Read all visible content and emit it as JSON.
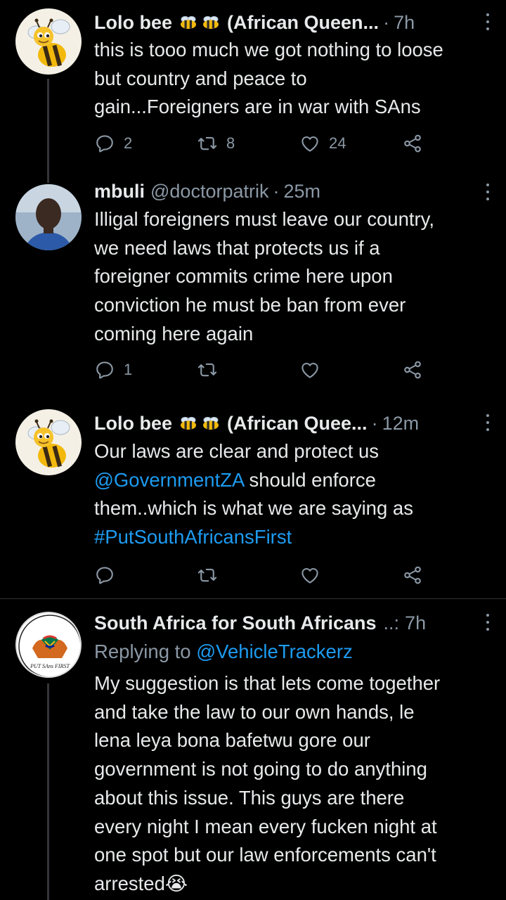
{
  "tweets": [
    {
      "name": "Lolo bee",
      "name_suffix": "(African Queen...",
      "time": "7h",
      "lines": [
        "this is tooo much we got nothing to loose",
        "but country and peace to",
        "gain...Foreigners are in war with SAns"
      ],
      "replies": "2",
      "retweets": "8",
      "likes": "24"
    },
    {
      "name": "mbuli",
      "handle": "@doctorpatrik",
      "time": "25m",
      "lines": [
        "Illigal foreigners must leave our country,",
        "we need laws that protects us if a",
        "foreigner commits crime here upon",
        "conviction he must be ban from ever",
        "coming here again"
      ],
      "replies": "1"
    },
    {
      "name": "Lolo bee",
      "name_suffix": "(African Quee...",
      "time": "12m",
      "line1": "Our laws are clear and protect us",
      "mention": "@GovernmentZA",
      "line2_rest": " should enforce",
      "line3": "them..which is what we are saying as",
      "hashtag": "#PutSouthAfricansFirst"
    },
    {
      "name": "South Africa for South Africans",
      "name_suffix": "..:",
      "time": "7h",
      "replying_label": "Replying to ",
      "replying_to": "@VehicleTrackerz",
      "lines": [
        "My suggestion is that lets come together",
        "and take the law to our own hands, le",
        "lena leya bona bafetwu gore our",
        "government is not going to do anything",
        "about this issue. This guys are there",
        "every night I mean every fucken night at",
        "one spot but our law enforcements can't"
      ],
      "last_line": "arrested",
      "emoji": "😭"
    }
  ],
  "avatar_logo_text": "PUT SAns FIRST",
  "colors": {
    "background": "#000000",
    "text": "#e7e9ea",
    "muted": "#8b98a5",
    "link": "#1d9bf0",
    "divider": "#2f3336"
  },
  "icons": [
    "reply-icon",
    "retweet-icon",
    "like-icon",
    "share-icon",
    "more-icon",
    "bee-emoji-icon",
    "crying-emoji-icon"
  ]
}
